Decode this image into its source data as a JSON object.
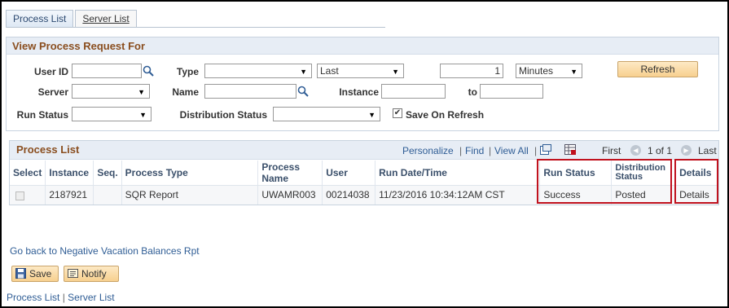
{
  "tabs": [
    "Process List",
    "Server List"
  ],
  "criteria": {
    "title": "View Process Request For",
    "user_id_label": "User ID",
    "user_id_value": "",
    "type_label": "Type",
    "type_value": "",
    "last_value": "Last",
    "last_count": "1",
    "unit_value": "Minutes",
    "refresh_label": "Refresh",
    "server_label": "Server",
    "server_value": "",
    "name_label": "Name",
    "name_value": "",
    "instance_label": "Instance",
    "instance_from": "",
    "to_label": "to",
    "instance_to": "",
    "run_status_label": "Run Status",
    "run_status_value": "",
    "dist_status_label": "Distribution Status",
    "dist_status_value": "",
    "save_on_refresh_label": "Save On Refresh",
    "save_on_refresh_checked": true
  },
  "grid": {
    "title": "Process List",
    "nav": {
      "personalize": "Personalize",
      "find": "Find",
      "view_all": "View All",
      "sep": "|"
    },
    "pager": {
      "first": "First",
      "range": "1 of 1",
      "last": "Last"
    },
    "columns": {
      "select": "Select",
      "instance": "Instance",
      "seq": "Seq.",
      "process_type": "Process Type",
      "process_name": "Process Name",
      "user": "User",
      "run_datetime": "Run Date/Time",
      "run_status": "Run Status",
      "dist_status": "Distribution Status",
      "details": "Details"
    },
    "rows": [
      {
        "instance": "2187921",
        "seq": "",
        "process_type": "SQR Report",
        "process_name": "UWAMR003",
        "user": "00214038",
        "run_datetime": "11/23/2016 10:34:12AM CST",
        "run_status": "Success",
        "dist_status": "Posted",
        "details": "Details"
      }
    ]
  },
  "footer": {
    "go_back": "Go back to Negative Vacation Balances Rpt",
    "save": "Save",
    "notify": "Notify",
    "link_process_list": "Process List",
    "link_sep": "|",
    "link_server_list": "Server List"
  },
  "colors": {
    "highlight": "#c0121e",
    "link": "#2f5d95",
    "section_title": "#8a4e1f"
  }
}
